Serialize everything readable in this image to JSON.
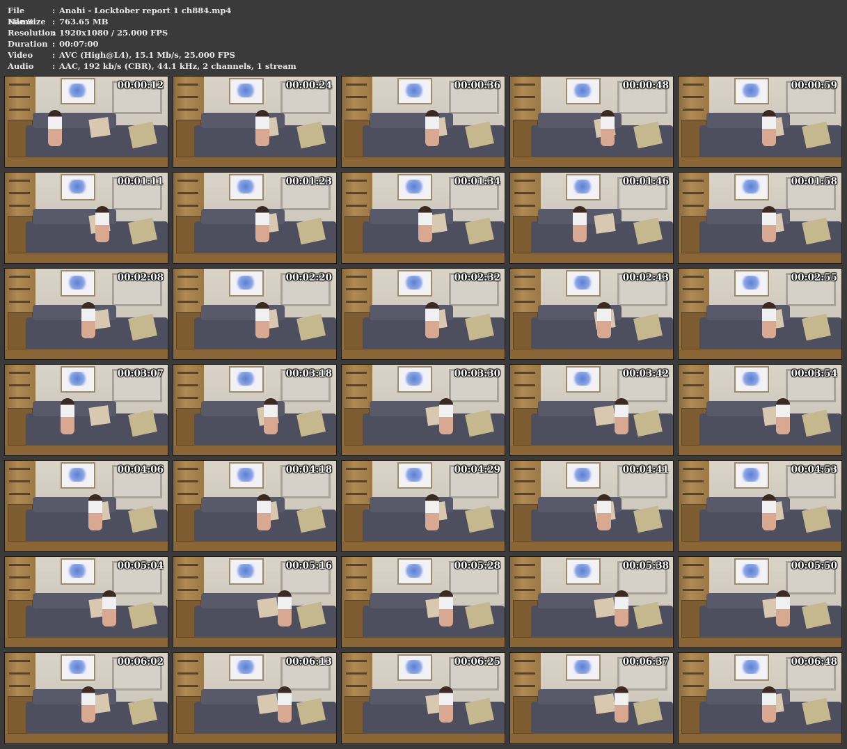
{
  "info": [
    {
      "label": "File Name",
      "sep": ":",
      "value": "Anahi - Locktober report 1 ch884.mp4"
    },
    {
      "label": "File Size",
      "sep": ":",
      "value": "763.65 MB"
    },
    {
      "label": "Resolution",
      "sep": ":",
      "value": "1920x1080 / 25.000 FPS"
    },
    {
      "label": "Duration",
      "sep": ":",
      "value": "00:07:00"
    },
    {
      "label": "Video",
      "sep": ":",
      "value": "AVC (High@L4), 15.1 Mb/s, 25.000 FPS"
    },
    {
      "label": "Audio",
      "sep": ":",
      "value": "AAC, 192 kb/s (CBR), 44.1 kHz, 2 channels, 1 stream"
    }
  ],
  "thumbnails": [
    {
      "time": "00:00:12"
    },
    {
      "time": "00:00:24"
    },
    {
      "time": "00:00:36"
    },
    {
      "time": "00:00:48"
    },
    {
      "time": "00:00:59"
    },
    {
      "time": "00:01:11"
    },
    {
      "time": "00:01:23"
    },
    {
      "time": "00:01:34"
    },
    {
      "time": "00:01:46"
    },
    {
      "time": "00:01:58"
    },
    {
      "time": "00:02:08"
    },
    {
      "time": "00:02:20"
    },
    {
      "time": "00:02:32"
    },
    {
      "time": "00:02:43"
    },
    {
      "time": "00:02:55"
    },
    {
      "time": "00:03:07"
    },
    {
      "time": "00:03:18"
    },
    {
      "time": "00:03:30"
    },
    {
      "time": "00:03:42"
    },
    {
      "time": "00:03:54"
    },
    {
      "time": "00:04:06"
    },
    {
      "time": "00:04:18"
    },
    {
      "time": "00:04:29"
    },
    {
      "time": "00:04:41"
    },
    {
      "time": "00:04:53"
    },
    {
      "time": "00:05:04"
    },
    {
      "time": "00:05:16"
    },
    {
      "time": "00:05:28"
    },
    {
      "time": "00:05:38"
    },
    {
      "time": "00:05:50"
    },
    {
      "time": "00:06:02"
    },
    {
      "time": "00:06:13"
    },
    {
      "time": "00:06:25"
    },
    {
      "time": "00:06:37"
    },
    {
      "time": "00:06:48"
    }
  ],
  "colors": {
    "background": "#3a3a3a",
    "text": "#e8e8e8",
    "timestamp": "#ffffff"
  }
}
